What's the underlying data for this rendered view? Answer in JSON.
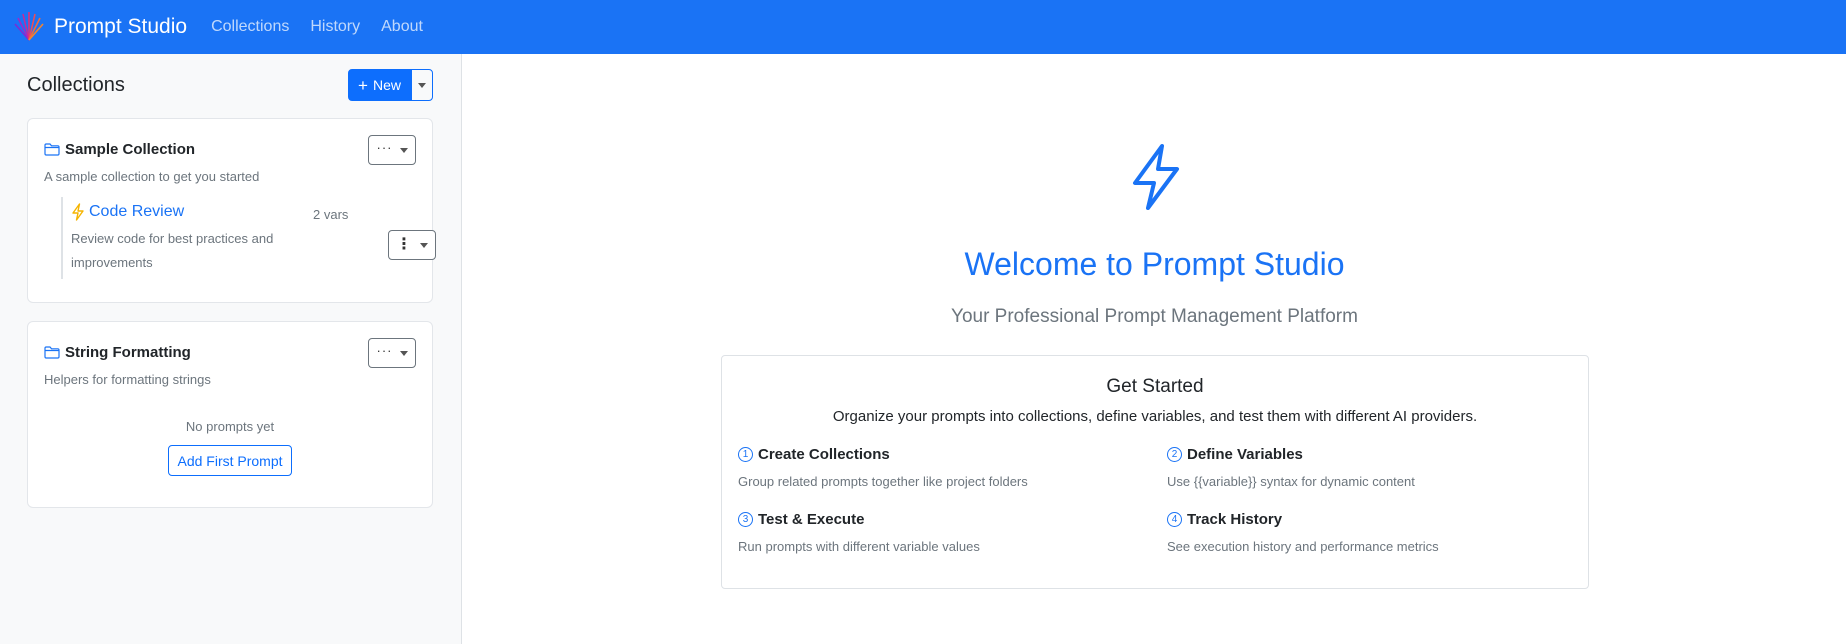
{
  "navbar": {
    "brand": "Prompt Studio",
    "links": [
      "Collections",
      "History",
      "About"
    ],
    "color": "#1a73f5"
  },
  "sidebar": {
    "title": "Collections",
    "new_button": "New",
    "collections": [
      {
        "name": "Sample Collection",
        "description": "A sample collection to get you started",
        "menu_label": "···",
        "prompts": [
          {
            "name": "Code Review",
            "vars": "2 vars",
            "description": "Review code for best practices and improvements"
          }
        ]
      },
      {
        "name": "String Formatting",
        "description": "Helpers for formatting strings",
        "menu_label": "···",
        "empty_text": "No prompts yet",
        "add_first_label": "Add First Prompt"
      }
    ]
  },
  "main": {
    "welcome": "Welcome to Prompt Studio",
    "tagline": "Your Professional Prompt Management Platform",
    "get_started": {
      "title": "Get Started",
      "subtitle": "Organize your prompts into collections, define variables, and test them with different AI providers.",
      "steps": [
        {
          "num": "1",
          "title": "Create Collections",
          "desc": "Group related prompts together like project folders"
        },
        {
          "num": "2",
          "title": "Define Variables",
          "desc": "Use {{variable}} syntax for dynamic content"
        },
        {
          "num": "3",
          "title": "Test & Execute",
          "desc": "Run prompts with different variable values"
        },
        {
          "num": "4",
          "title": "Track History",
          "desc": "See execution history and performance metrics"
        }
      ]
    }
  },
  "icons": {
    "brand": "logo-icon",
    "folder": "folder-icon",
    "bolt": "lightning-icon",
    "prompt_bolt_color": "#f5b400"
  }
}
